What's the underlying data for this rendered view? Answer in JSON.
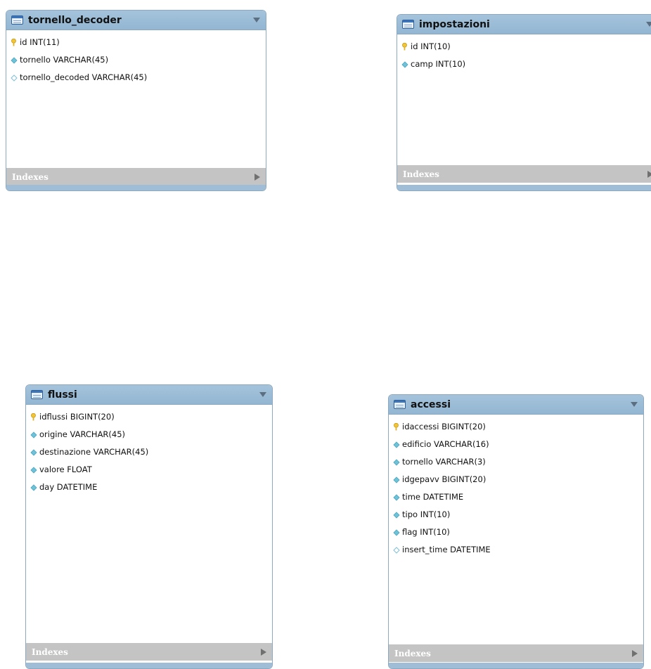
{
  "colors": {
    "header_bg": "#9fbfd9",
    "indexes_bg": "#c4c4c4",
    "primary_key_icon": "#f2c534",
    "column_icon": "#6fc3d8",
    "nullable_icon_outline": "#7fbfd6"
  },
  "indexes_label": "Indexes",
  "tables": [
    {
      "name": "tornello_decoder",
      "columns": [
        {
          "text": "id INT(11)",
          "icon": "primary-key-icon"
        },
        {
          "text": "tornello VARCHAR(45)",
          "icon": "column-diamond-icon"
        },
        {
          "text": "tornello_decoded VARCHAR(45)",
          "icon": "nullable-diamond-icon"
        }
      ]
    },
    {
      "name": "impostazioni",
      "columns": [
        {
          "text": "id INT(10)",
          "icon": "primary-key-icon"
        },
        {
          "text": "camp INT(10)",
          "icon": "column-diamond-icon"
        }
      ]
    },
    {
      "name": "flussi",
      "columns": [
        {
          "text": "idflussi BIGINT(20)",
          "icon": "primary-key-icon"
        },
        {
          "text": "origine VARCHAR(45)",
          "icon": "column-diamond-icon"
        },
        {
          "text": "destinazione VARCHAR(45)",
          "icon": "column-diamond-icon"
        },
        {
          "text": "valore FLOAT",
          "icon": "column-diamond-icon"
        },
        {
          "text": "day DATETIME",
          "icon": "column-diamond-icon"
        }
      ]
    },
    {
      "name": "accessi",
      "columns": [
        {
          "text": "idaccessi BIGINT(20)",
          "icon": "primary-key-icon"
        },
        {
          "text": "edificio VARCHAR(16)",
          "icon": "column-diamond-icon"
        },
        {
          "text": "tornello VARCHAR(3)",
          "icon": "column-diamond-icon"
        },
        {
          "text": "idgepavv BIGINT(20)",
          "icon": "column-diamond-icon"
        },
        {
          "text": "time DATETIME",
          "icon": "column-diamond-icon"
        },
        {
          "text": "tipo INT(10)",
          "icon": "column-diamond-icon"
        },
        {
          "text": "flag INT(10)",
          "icon": "column-diamond-icon"
        },
        {
          "text": "insert_time DATETIME",
          "icon": "nullable-diamond-icon"
        }
      ]
    }
  ]
}
